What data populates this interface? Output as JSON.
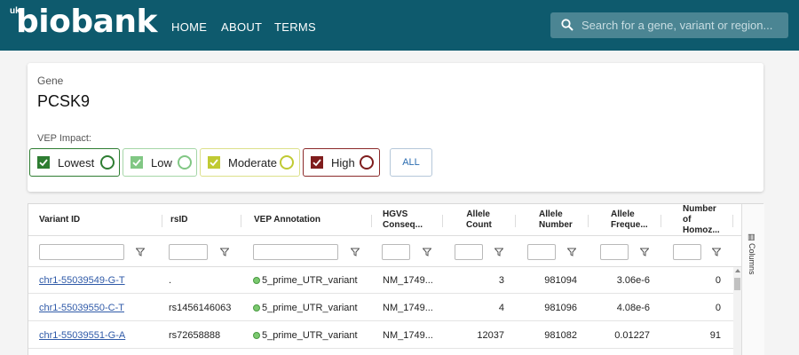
{
  "brand": {
    "prefix": "uk",
    "name": "biobank"
  },
  "nav": {
    "home": "HOME",
    "about": "ABOUT",
    "terms": "TERMS"
  },
  "search": {
    "placeholder": "Search for a gene, variant or region..."
  },
  "gene": {
    "label": "Gene",
    "name": "PCSK9"
  },
  "vep": {
    "label": "VEP Impact:",
    "chips": [
      {
        "label": "Lowest",
        "color": "#2e7d32"
      },
      {
        "label": "Low",
        "color": "#81c784"
      },
      {
        "label": "Moderate",
        "color": "#c0ca33"
      },
      {
        "label": "High",
        "color": "#7f1d1d"
      }
    ],
    "all_label": "ALL"
  },
  "table": {
    "headers": {
      "variant_id": "Variant ID",
      "rsid": "rsID",
      "vep_annotation": "VEP Annotation",
      "hgvs_1": "HGVS",
      "hgvs_2": "Conseq...",
      "allele_count_1": "Allele",
      "allele_count_2": "Count",
      "allele_number_1": "Allele",
      "allele_number_2": "Number",
      "allele_freq_1": "Allele",
      "allele_freq_2": "Freque...",
      "homoz_1": "Number",
      "homoz_2": "of",
      "homoz_3": "Homoz..."
    },
    "rows": [
      {
        "variant_id": "chr1-55039549-G-T",
        "rsid": ".",
        "vep": "5_prime_UTR_variant",
        "hgvs": "NM_1749...",
        "allele_count": "3",
        "allele_number": "981094",
        "allele_freq": "3.06e-6",
        "homoz": "0"
      },
      {
        "variant_id": "chr1-55039550-C-T",
        "rsid": "rs1456146063",
        "vep": "5_prime_UTR_variant",
        "hgvs": "NM_1749...",
        "allele_count": "4",
        "allele_number": "981096",
        "allele_freq": "4.08e-6",
        "homoz": "0"
      },
      {
        "variant_id": "chr1-55039551-G-A",
        "rsid": "rs72658888",
        "vep": "5_prime_UTR_variant",
        "hgvs": "NM_1749...",
        "allele_count": "12037",
        "allele_number": "981082",
        "allele_freq": "0.01227",
        "homoz": "91"
      }
    ],
    "columns_panel_label": "Columns"
  }
}
